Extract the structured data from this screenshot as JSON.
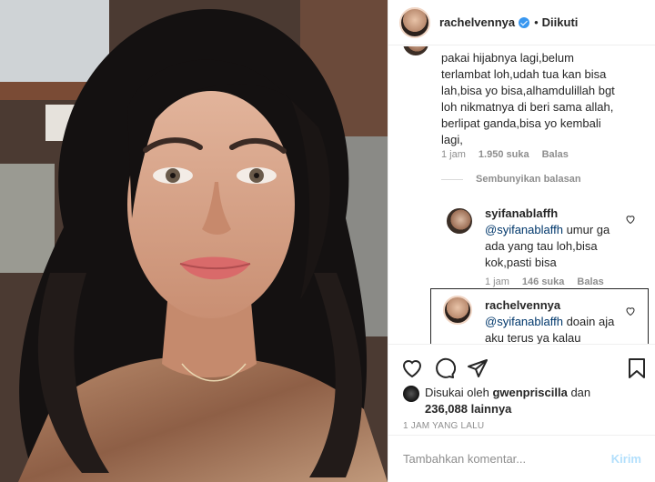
{
  "post": {
    "username": "rachelvennya",
    "follow_state": "Diikuti",
    "dot": "•"
  },
  "comments": {
    "main": {
      "text_lines": [
        "pakai hijabnya lagi,belum",
        "terlambat loh,udah tua kan bisa",
        "lah,bisa yo bisa,alhamdulillah bgt",
        "loh nikmatnya di beri sama allah,",
        "berlipat ganda,bisa yo kembali",
        "lagi,"
      ],
      "time": "1 jam",
      "likes": "1.950 suka",
      "reply": "Balas"
    },
    "hide_replies": "Sembunyikan balasan",
    "reply1": {
      "username": "syifanablaffh",
      "mention": "@syifanablaffh",
      "text_rest": " umur ga ada yang tau loh,bisa kok,pasti bisa",
      "time": "1 jam",
      "likes": "146 suka",
      "reply": "Balas"
    },
    "reply2": {
      "username": "rachelvennya",
      "mention": "@syifanablaffh",
      "text_rest": " doain aja aku terus ya kalau"
    }
  },
  "likes": {
    "prefix": "Disukai oleh",
    "liker": "gwenpriscilla",
    "joiner": "dan",
    "count": "236,088 lainnya"
  },
  "timestamp": "1 JAM YANG LALU",
  "composer": {
    "placeholder": "Tambahkan komentar...",
    "post_label": "Kirim"
  },
  "colors": {
    "verified": "#3897f0",
    "mention": "#00376b",
    "post_disabled": "#b2dffc",
    "muted": "#8e8e8e"
  },
  "icons": [
    "verified-badge-icon",
    "heart-icon",
    "comment-icon",
    "share-icon",
    "bookmark-icon",
    "comment-like-icon"
  ]
}
